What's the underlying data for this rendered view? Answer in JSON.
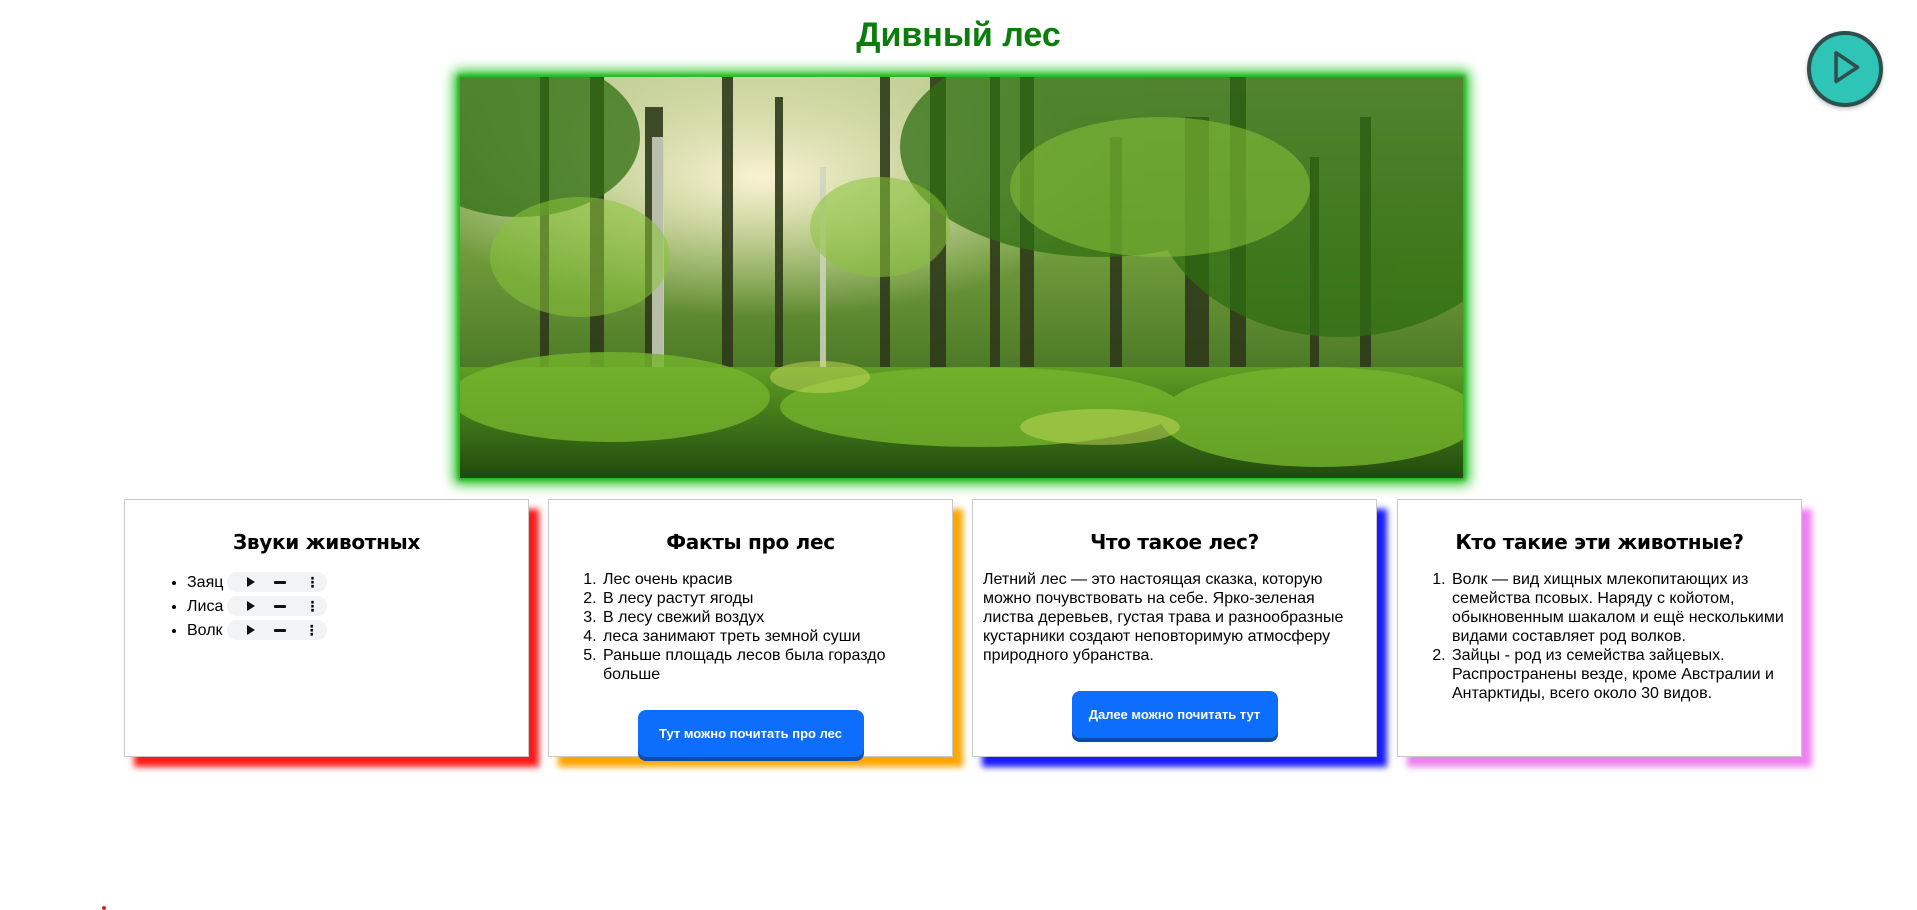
{
  "page": {
    "title": "Дивный лес",
    "play_icon": "play-icon",
    "hero_image_icon": "forest-photo"
  },
  "cards": {
    "sounds": {
      "heading": "Звуки животных",
      "items": [
        "Заяц",
        "Лиса",
        "Волк"
      ],
      "accent": "#ff1a1a"
    },
    "facts": {
      "heading": "Факты про лес",
      "items": [
        "Лес очень красив",
        "В лесу растут ягоды",
        "В лесу свежий воздух",
        "леса занимают треть земной суши",
        "Раньше площадь лесов была гораздо больше"
      ],
      "button": "Тут можно почитать про лес",
      "accent": "#ffa500"
    },
    "what": {
      "heading": "Что такое лес?",
      "text": "Летний лес — это настоящая сказка, которую можно почувствовать на себе. Ярко-зеленая листва деревьев, густая трава и разнообразные кустарники создают неповторимую атмосферу природного убранства.",
      "button": "Далее можно почитать тут",
      "accent": "#1a1aff"
    },
    "animals": {
      "heading": "Кто такие эти животные?",
      "items": [
        "Волк — вид хищных млекопитающих из семейства псовых. Наряду с койотом, обыкновенным шакалом и ещё несколькими видами составляет род волков.",
        "Зайцы - род из семейства зайцевых. Распространены везде, кроме Австралии и Антарктиды, всего около 30 видов."
      ],
      "accent": "#ee82ee"
    }
  },
  "colors": {
    "title": "#0a7d0a",
    "button": "#0d6efd",
    "fab": "#2ec4b6"
  }
}
